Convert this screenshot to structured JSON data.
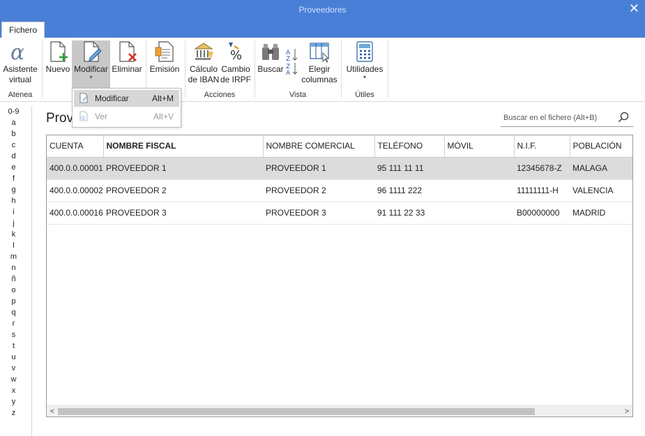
{
  "window": {
    "title": "Proveedores",
    "close_glyph": "✕"
  },
  "tabs": [
    {
      "label": "Fichero"
    }
  ],
  "ribbon": {
    "buttons": [
      {
        "line1": "Asistente",
        "line2": "virtual",
        "icon": "atenea-alpha-icon"
      },
      {
        "line1": "Nuevo",
        "line2": "",
        "icon": "new-document-icon"
      },
      {
        "line1": "Modificar",
        "line2": "",
        "icon": "edit-document-icon",
        "caret": "▾"
      },
      {
        "line1": "Eliminar",
        "line2": "",
        "icon": "delete-document-icon"
      },
      {
        "line1": "Emisión",
        "line2": "",
        "icon": "issue-document-icon"
      },
      {
        "line1": "Cálculo",
        "line2": "de IBAN",
        "icon": "bank-iban-icon"
      },
      {
        "line1": "Cambio",
        "line2": "de IRPF",
        "icon": "percent-icon"
      },
      {
        "line1": "Buscar",
        "line2": "",
        "icon": "binoculars-icon"
      },
      {
        "line1": "Elegir",
        "line2": "columnas",
        "icon": "columns-icon"
      },
      {
        "line1": "Utilidades",
        "line2": "",
        "icon": "calculator-icon",
        "caret": "▾"
      }
    ],
    "groups": [
      "Atenea",
      "Acciones",
      "Vista",
      "Útiles"
    ]
  },
  "dropdown": {
    "items": [
      {
        "label": "Modificar",
        "shortcut": "Alt+M",
        "enabled": true
      },
      {
        "label": "Ver",
        "shortcut": "Alt+V",
        "enabled": false
      }
    ]
  },
  "alphabet": [
    "0-9",
    "a",
    "b",
    "c",
    "d",
    "e",
    "f",
    "g",
    "h",
    "i",
    "j",
    "k",
    "l",
    "m",
    "n",
    "ñ",
    "o",
    "p",
    "q",
    "r",
    "s",
    "t",
    "u",
    "v",
    "w",
    "x",
    "y",
    "z"
  ],
  "page": {
    "title": "Prov"
  },
  "search": {
    "placeholder": "Buscar en el fichero (Alt+B)"
  },
  "table": {
    "columns": [
      "CUENTA",
      "NOMBRE FISCAL",
      "NOMBRE COMERCIAL",
      "TELÉFONO",
      "MÓVIL",
      "N.I.F.",
      "POBLACIÓN"
    ],
    "rows": [
      [
        "400.0.0.00001",
        "PROVEEDOR 1",
        "PROVEEDOR 1",
        "95 111 11 11",
        "",
        "12345678-Z",
        "MALAGA"
      ],
      [
        "400.0.0.00002",
        "PROVEEDOR 2",
        "PROVEEDOR 2",
        "96 1111 222",
        "",
        "11111111-H",
        "VALENCIA"
      ],
      [
        "400.0.0.00016",
        "PROVEEDOR 3",
        "PROVEEDOR 3",
        "91 111 22 33",
        "",
        "B00000000",
        "MADRID"
      ]
    ],
    "selected_row": 0
  },
  "scrollbar": {
    "left_glyph": "<",
    "right_glyph": ">"
  },
  "colors": {
    "titlebar": "#4a7fd8",
    "selection": "#dcdcdc",
    "active_button": "#c8c8c8"
  }
}
